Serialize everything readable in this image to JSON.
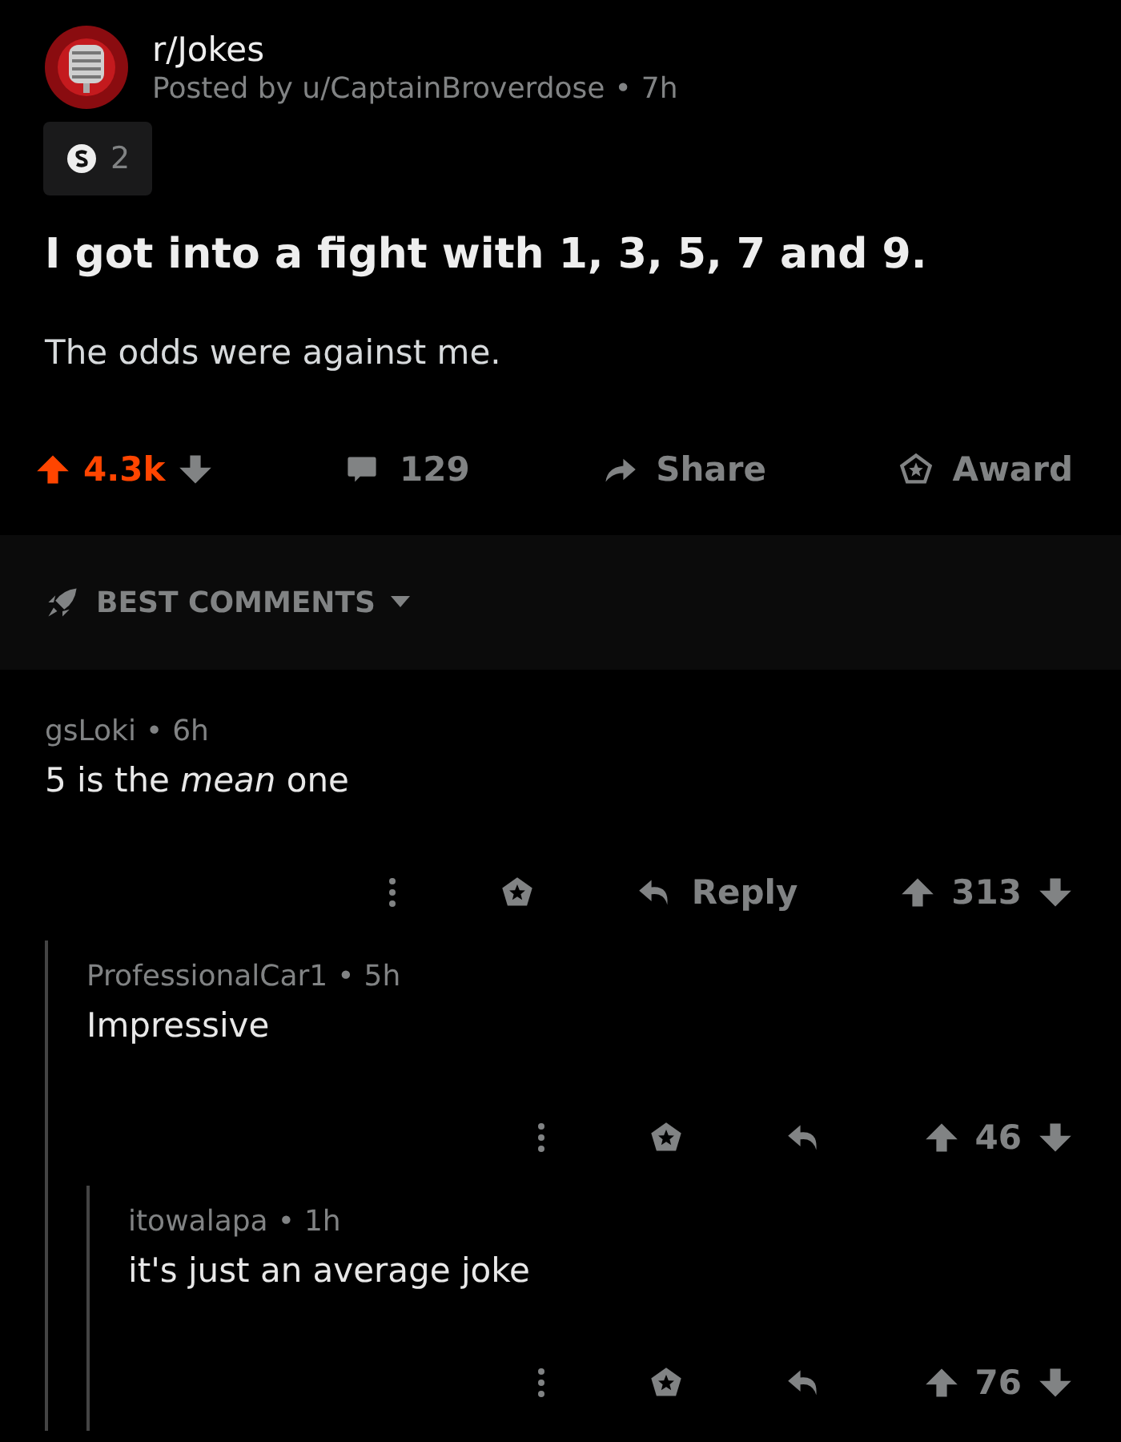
{
  "post": {
    "subreddit": "r/Jokes",
    "posted_by": "Posted by u/CaptainBroverdose",
    "separator": "•",
    "age": "7h",
    "award_count": "2",
    "title": "I got into a fight with 1, 3, 5, 7 and 9.",
    "body": "The odds were against me.",
    "score": "4.3k",
    "upvoted": true,
    "comments": "129",
    "share": "Share",
    "award": "Award"
  },
  "sort": {
    "label": "BEST COMMENTS"
  },
  "comments": [
    {
      "author": "gsLoki",
      "separator": "•",
      "age": "6h",
      "body": "5 is the *mean* one",
      "reply_label": "Reply",
      "score": "313",
      "children": [
        {
          "author": "ProfessionalCar1",
          "separator": "•",
          "age": "5h",
          "body": "Impressive",
          "score": "46",
          "children": [
            {
              "author": "itowalapa",
              "separator": "•",
              "age": "1h",
              "body": "it's just an average joke",
              "score": "76"
            }
          ]
        }
      ]
    }
  ]
}
